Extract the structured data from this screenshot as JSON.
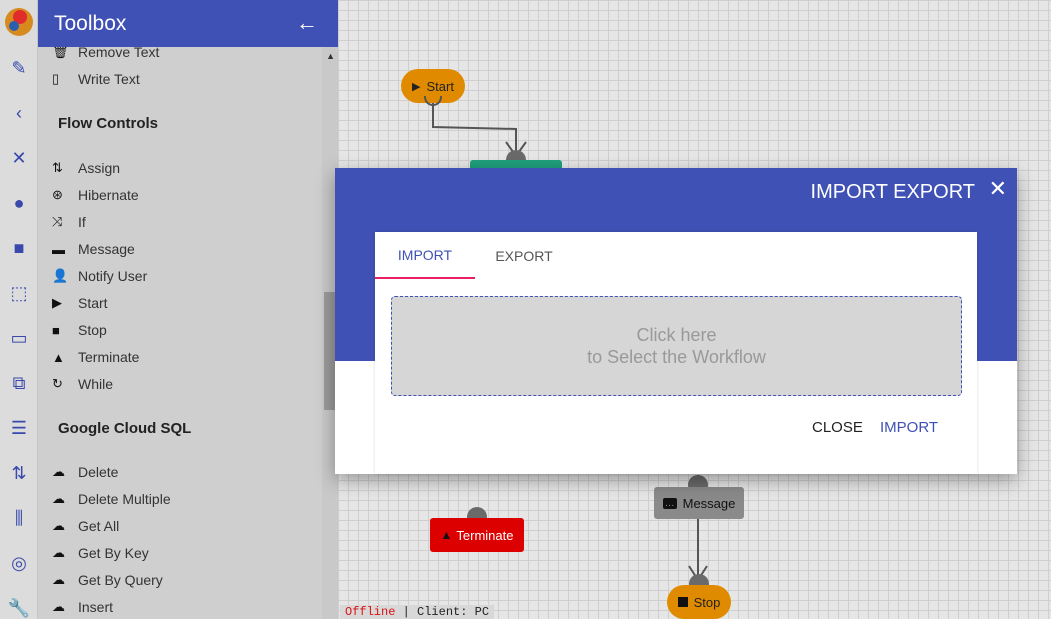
{
  "toolbox": {
    "title": "Toolbox",
    "items_top": [
      {
        "label": "Remove Text",
        "icon": "trash-icon"
      },
      {
        "label": "Write Text",
        "icon": "file-icon"
      }
    ],
    "sections": [
      {
        "heading": "Flow Controls",
        "items": [
          {
            "label": "Assign",
            "icon": "assign-icon"
          },
          {
            "label": "Hibernate",
            "icon": "hibernate-icon"
          },
          {
            "label": "If",
            "icon": "shuffle-icon"
          },
          {
            "label": "Message",
            "icon": "message-icon"
          },
          {
            "label": "Notify User",
            "icon": "user-icon"
          },
          {
            "label": "Start",
            "icon": "play-icon"
          },
          {
            "label": "Stop",
            "icon": "stop-icon"
          },
          {
            "label": "Terminate",
            "icon": "warning-icon"
          },
          {
            "label": "While",
            "icon": "loop-icon"
          }
        ]
      },
      {
        "heading": "Google Cloud SQL",
        "items": [
          {
            "label": "Delete",
            "icon": "cloud-icon"
          },
          {
            "label": "Delete Multiple",
            "icon": "cloud-icon"
          },
          {
            "label": "Get All",
            "icon": "cloud-icon"
          },
          {
            "label": "Get By Key",
            "icon": "cloud-icon"
          },
          {
            "label": "Get By Query",
            "icon": "cloud-icon"
          },
          {
            "label": "Insert",
            "icon": "cloud-icon"
          }
        ]
      }
    ]
  },
  "canvas": {
    "nodes": {
      "start": "Start",
      "message": "Message",
      "terminate": "Terminate",
      "stop": "Stop"
    },
    "status": {
      "offline": "Offline",
      "separator": " | ",
      "client": "Client: PC"
    }
  },
  "dialog": {
    "title": "IMPORT EXPORT",
    "tabs": [
      "IMPORT",
      "EXPORT"
    ],
    "dropzone_line1": "Click here",
    "dropzone_line2": "to Select the Workflow",
    "close_label": "CLOSE",
    "import_label": "IMPORT"
  }
}
